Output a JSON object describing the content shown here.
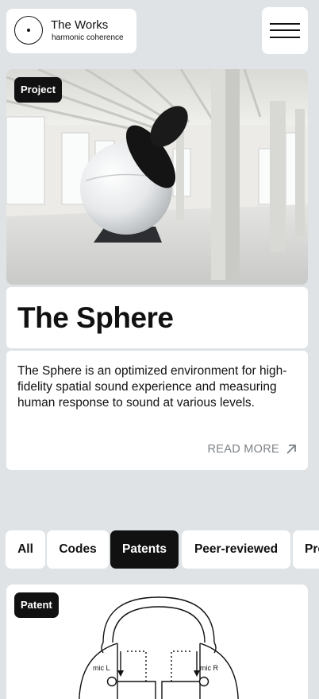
{
  "header": {
    "logo_title": "The Works",
    "logo_subtitle": "harmonic coherence",
    "menu_icon": "hamburger-menu-icon"
  },
  "featured": {
    "badge": "Project",
    "title": "The Sphere",
    "description": "The Sphere is an optimized environment for high-fidelity spatial sound experience and measuring human response to sound at various levels.",
    "read_more": "READ MORE",
    "read_more_icon": "arrow-up-right-icon"
  },
  "filters": {
    "items": [
      "All",
      "Codes",
      "Patents",
      "Peer-reviewed",
      "Pro"
    ],
    "active": "Patents"
  },
  "patent_card": {
    "badge": "Patent",
    "diagram": {
      "left_mic_label": "mic L",
      "right_mic_label": "mic R"
    }
  },
  "colors": {
    "background": "#dfe3e6",
    "card": "#ffffff",
    "accent": "#111111",
    "muted_text": "#7d8287"
  }
}
